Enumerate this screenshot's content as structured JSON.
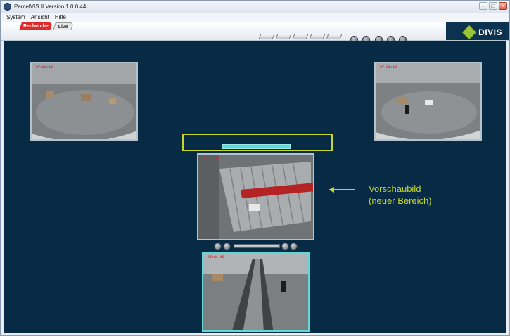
{
  "window": {
    "title": "ParcelVIS II Version 1.0.0.44"
  },
  "menu": {
    "items": [
      "System",
      "Ansicht",
      "Hilfe"
    ]
  },
  "tabs": {
    "recherche": "Recherche",
    "live": "Live"
  },
  "logo": {
    "text": "DIVIS"
  },
  "cameras": {
    "top_left": {
      "timestamp": "07:21:19"
    },
    "top_right": {
      "timestamp": "07:21:19"
    },
    "center": {
      "timestamp": "07:21:19"
    },
    "bottom": {
      "timestamp": "07:21:19"
    }
  },
  "progress": {
    "value": 0.45
  },
  "annotation": {
    "line1": "Vorschaubild",
    "line2": "(neuer Bereich)"
  },
  "colors": {
    "accent": "#c5d52c",
    "background": "#082b45",
    "highlight": "#5fd8d6",
    "tab_active": "#e02a2a"
  }
}
